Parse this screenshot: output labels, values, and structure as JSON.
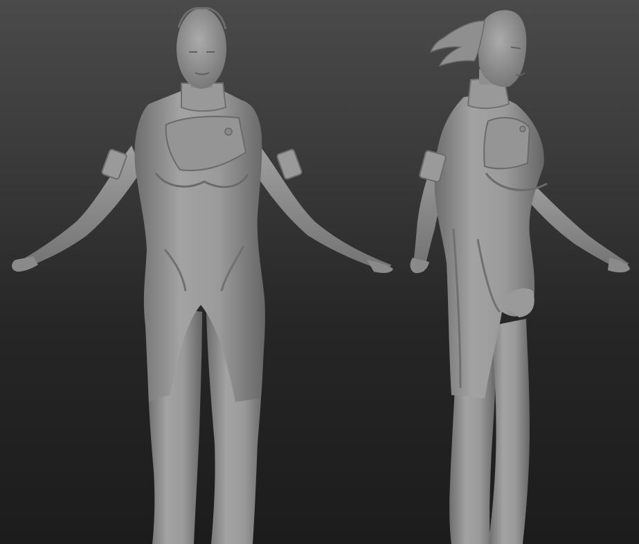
{
  "scene": {
    "background_top": "#4a4a4a",
    "background_bottom": "#1c1c1c",
    "clay_color": "#8c8c8c",
    "clay_highlight": "#a8a8a8",
    "clay_shadow": "#5e5e5e"
  },
  "figures": [
    {
      "view": "front"
    },
    {
      "view": "three-quarter"
    }
  ]
}
